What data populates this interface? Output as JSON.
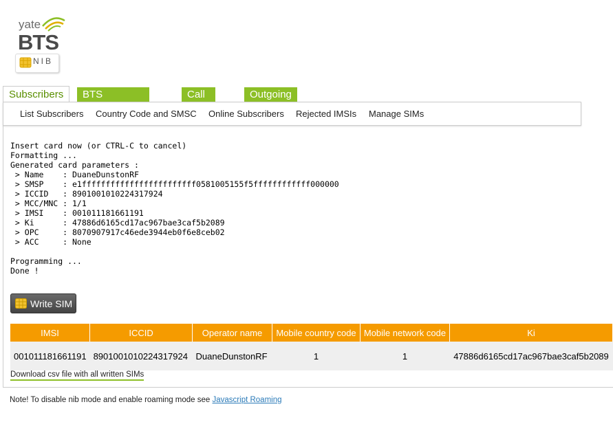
{
  "logo": {
    "yate": "yate",
    "bts": "BTS",
    "nib": "NIB"
  },
  "tabs": [
    {
      "label": "Subscribers",
      "active": true
    },
    {
      "label": "BTS Configuration",
      "active": false
    },
    {
      "label": "Call Logs",
      "active": false
    },
    {
      "label": "Outgoing",
      "active": false
    }
  ],
  "subnav": [
    "List Subscribers",
    "Country Code and SMSC",
    "Online Subscribers",
    "Rejected IMSIs",
    "Manage SIMs"
  ],
  "console_lines": [
    "Insert card now (or CTRL-C to cancel)",
    "Formatting ...",
    "Generated card parameters :",
    " > Name    : DuaneDunstonRF",
    " > SMSP    : e1ffffffffffffffffffffffff0581005155f5ffffffffffff000000",
    " > ICCID   : 8901001010224317924",
    " > MCC/MNC : 1/1",
    " > IMSI    : 001011181661191",
    " > Ki      : 47886d6165cd17ac967bae3caf5b2089",
    " > OPC     : 8070907917c46ede3944eb0f6e8ceb02",
    " > ACC     : None",
    "",
    "Programming ...",
    "Done !"
  ],
  "write_button": "Write SIM",
  "table": {
    "headers": [
      "IMSI",
      "ICCID",
      "Operator name",
      "Mobile country code",
      "Mobile network code",
      "Ki"
    ],
    "rows": [
      [
        "001011181661191",
        "8901001010224317924",
        "DuaneDunstonRF",
        "1",
        "1",
        "47886d6165cd17ac967bae3caf5b2089"
      ]
    ]
  },
  "csv_link": "Download csv file with all written SIMs",
  "note": {
    "text": "Note! To disable nib mode and enable roaming mode see ",
    "link": "Javascript Roaming"
  },
  "colors": {
    "tab_green": "#8cbf26",
    "active_tab_text": "#5a8f00",
    "table_header": "#f59b00",
    "link_blue": "#2a7ab8"
  }
}
